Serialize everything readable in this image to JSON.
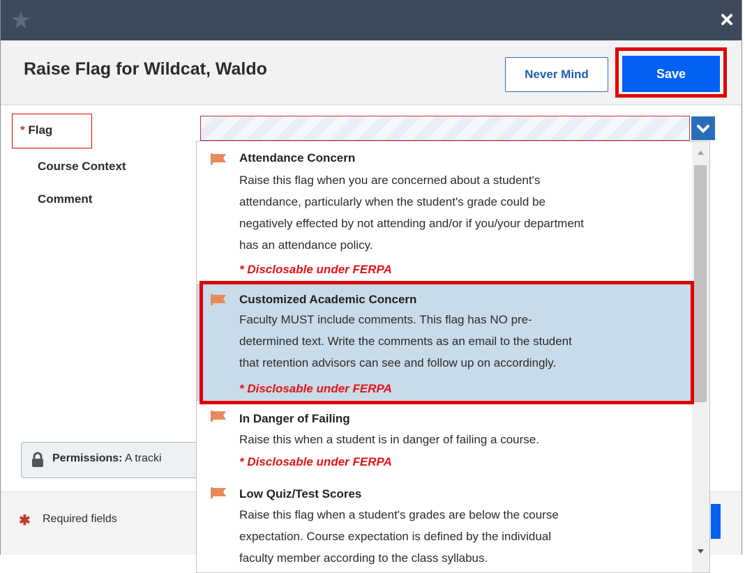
{
  "dialog": {
    "title": "Raise Flag for Wildcat, Waldo",
    "never_mind_label": "Never Mind",
    "save_label": "Save"
  },
  "form": {
    "flag_label": "Flag",
    "course_context_label": "Course Context",
    "comment_label": "Comment",
    "required_marker": "*"
  },
  "dropdown": {
    "items": [
      {
        "title": "Attendance Concern",
        "description": "Raise this flag when you are concerned about a student's\nattendance, particularly when the student's grade could be\nnegatively effected by not attending and/or if you/your department\nhas an attendance policy.",
        "ferpa": "* Disclosable under FERPA"
      },
      {
        "title": "Customized Academic Concern",
        "description": "Faculty MUST include comments. This flag has NO pre-\ndetermined text. Write the comments as an email to the student\nthat retention advisors can see and follow up on accordingly.",
        "ferpa": "* Disclosable under FERPA",
        "selected": true
      },
      {
        "title": "In Danger of Failing",
        "description": "Raise this when a student is in danger of failing a course.",
        "ferpa": "* Disclosable under FERPA"
      },
      {
        "title": "Low Quiz/Test Scores",
        "description": "Raise this flag when a student's grades are below the course\nexpectation. Course expectation is defined by the individual\nfaculty member according to the class syllabus.",
        "ferpa": ""
      }
    ]
  },
  "permissions": {
    "label": "Permissions:",
    "text": "A tracki"
  },
  "footer": {
    "required_text": "Required fields",
    "required_marker": "✱"
  },
  "colors": {
    "titlebar": "#3d4a5c",
    "primary": "#0061f2",
    "highlight_border": "#e00000",
    "selected_row": "#c9dbe9",
    "ferpa_text": "#e11414",
    "flag_icon": "#e8895a"
  }
}
